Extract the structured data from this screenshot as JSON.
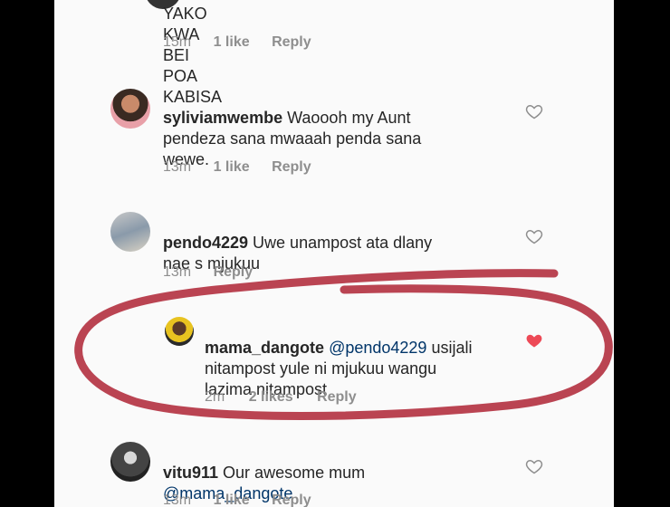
{
  "comments": [
    {
      "id": "top-partial",
      "text": "YAKO KWA BEI POA KABISA",
      "time": "15m",
      "likes": "1 like",
      "reply": "Reply"
    },
    {
      "id": "syliviamwembe",
      "username": "syliviamwembe",
      "text_line1": " Waoooh my Aunt",
      "text_rest": "pendeza sana mwaaah penda sana\nwewe.",
      "time": "13m",
      "likes": "1 like",
      "reply": "Reply",
      "liked": false
    },
    {
      "id": "pendo4229",
      "username": "pendo4229",
      "text_line1": " Uwe unampost ata dlany",
      "text_rest": "nae s mjukuu",
      "time": "13m",
      "reply": "Reply",
      "liked": false
    },
    {
      "id": "mama_dangote",
      "username": "mama_dangote",
      "mention": "@pendo4229",
      "text_line1": " usijali",
      "text_rest": "nitampost yule ni mjukuu wangu\nlazima nitampost",
      "time": "2m",
      "likes": "2 likes",
      "reply": "Reply",
      "liked": true
    },
    {
      "id": "vitu911",
      "username": "vitu911",
      "text_line1": " Our awesome mum",
      "mention": "@mama_dangote",
      "time": "13m",
      "likes": "1 like",
      "reply": "Reply",
      "liked": false
    }
  ],
  "colors": {
    "highlight_circle": "#b2303f",
    "heart_liked": "#ed4956",
    "heart_outline": "#8e8e8e"
  }
}
